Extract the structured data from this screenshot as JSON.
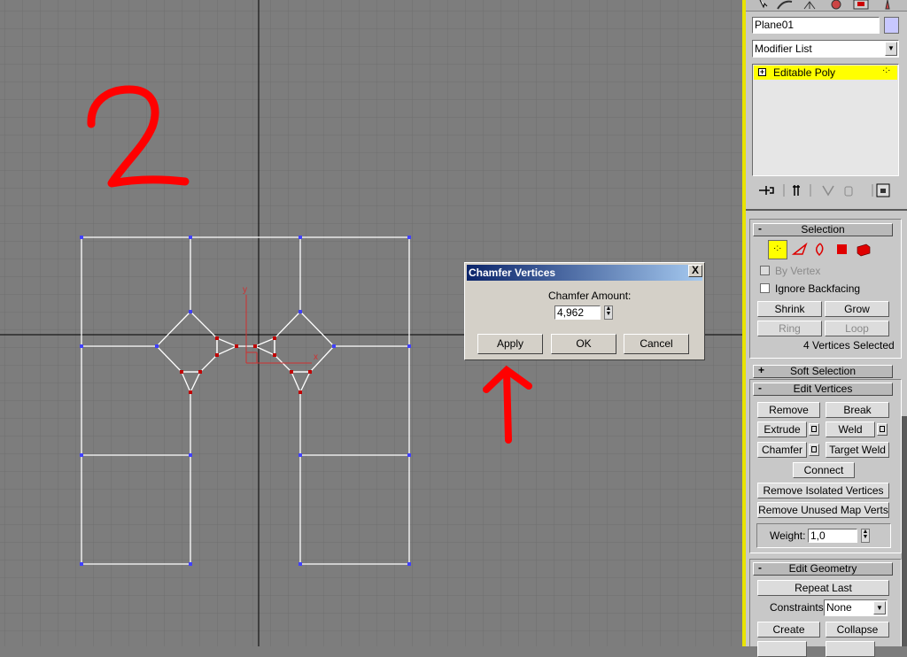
{
  "object_name": "Plane01",
  "modifier_list": "Modifier List",
  "modifier_stack": [
    {
      "label": "Editable Poly",
      "selected": true
    }
  ],
  "viewport": {
    "annotation_number": "2",
    "gizmo_x_label": "x",
    "gizmo_y_label": "y"
  },
  "dialog": {
    "title": "Chamfer Vertices",
    "amount_label": "Chamfer Amount:",
    "amount_value": "4,962",
    "apply": "Apply",
    "ok": "OK",
    "cancel": "Cancel",
    "close": "X"
  },
  "selection": {
    "title": "Selection",
    "by_vertex": "By Vertex",
    "ignore_backfacing": "Ignore Backfacing",
    "shrink": "Shrink",
    "grow": "Grow",
    "ring": "Ring",
    "loop": "Loop",
    "status": "4 Vertices Selected"
  },
  "soft_selection": {
    "title": "Soft Selection"
  },
  "edit_vertices": {
    "title": "Edit Vertices",
    "remove": "Remove",
    "break": "Break",
    "extrude": "Extrude",
    "weld": "Weld",
    "chamfer": "Chamfer",
    "target_weld": "Target Weld",
    "connect": "Connect",
    "remove_isolated": "Remove Isolated Vertices",
    "remove_unused": "Remove Unused Map Verts",
    "weight_label": "Weight:",
    "weight_value": "1,0"
  },
  "edit_geometry": {
    "title": "Edit Geometry",
    "repeat_last": "Repeat Last",
    "constraints_label": "Constraints:",
    "constraints_value": "None",
    "create": "Create",
    "collapse": "Collapse"
  },
  "colors": {
    "viewport_bg": "#7d7d7d",
    "panel_bg": "#c8c8c8",
    "accent_yellow": "#ffff00",
    "annotation_red": "#ff0000",
    "selected_vertex": "#c00000",
    "vertex_blue": "#4040ff",
    "dialog_title_blue": "#0a246a"
  },
  "icons": [
    "select-arrow-icon",
    "curve-icon",
    "hierarchy-icon",
    "motion-icon",
    "display-icon",
    "utilities-icon",
    "pin-stack-icon",
    "show-end-result-icon",
    "make-unique-icon",
    "remove-modifier-icon",
    "configure-sets-icon",
    "vertex-icon",
    "edge-icon",
    "border-icon",
    "polygon-icon",
    "element-icon",
    "dropdown-arrow-icon",
    "spinner-icon"
  ]
}
